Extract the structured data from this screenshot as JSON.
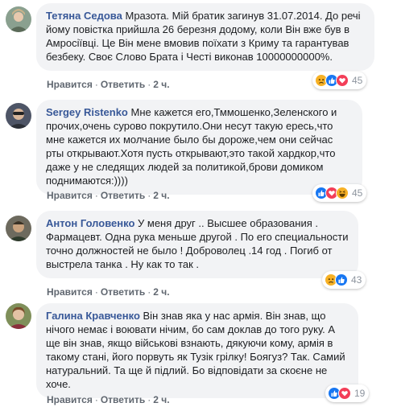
{
  "comments": [
    {
      "author": "Тетяна Седова",
      "text": "Мразота. Мій братик загинув 31.07.2014. До речі йому повістка прийшла 26 березня додому, коли Він вже був в Амросіївці. Це Він мене вмовив поїхати з Криму та гарантував безбеку. Своє Слово Брата і Честі виконав 10000000000%.",
      "like_label": "Нравится",
      "reply_label": "Ответить",
      "time": "2 ч.",
      "reactions": [
        "sad-icon",
        "like-icon",
        "love-icon"
      ],
      "reaction_count": "45"
    },
    {
      "author": "Sergey Ristenko",
      "text": "Мне кажется его,Тммошенко,Зеленского и прочих,очень сурово покрутило.Они несут такую ересь,что мне кажется их молчание было бы дороже,чем они сейчас рты открывают.Хотя пусть открывают,это такой хардкор,что даже у не следящих людей за политикой,брови домиком поднимаются:))))",
      "like_label": "Нравится",
      "reply_label": "Ответить",
      "time": "2 ч.",
      "reactions": [
        "like-icon",
        "love-icon",
        "haha-icon"
      ],
      "reaction_count": "45"
    },
    {
      "author": "Антон Головенко",
      "text": "У меня друг .. Высшее образования . Фармацевт. Одна рука меньше другой . По его специальности точно должностей не было ! Доброволец .14 год . Погиб от выстрела танка . Ну как то так .",
      "like_label": "Нравится",
      "reply_label": "Ответить",
      "time": "2 ч.",
      "reactions": [
        "sad-icon",
        "like-icon"
      ],
      "reaction_count": "43"
    },
    {
      "author": "Галина Кравченко",
      "text": "Він знав яка у нас армія. Він знав, що нічого немає і воювати нічим, бо сам доклав до того руку. А ще він знав, якщо військові взнають, дякуючи кому, армія в такому стані, його порвуть як Тузік грілку! Боягуз? Так. Самий натуральний. Та ще й підлий. Бо відповідати за скоєне не хоче.",
      "like_label": "Нравится",
      "reply_label": "Ответить",
      "time": "2 ч.",
      "reactions": [
        "like-icon",
        "love-icon"
      ],
      "reaction_count": "19"
    }
  ],
  "colors": {
    "author": "#385898",
    "bubble": "#f2f3f5",
    "like": "#1877f2",
    "love": "#f33e58",
    "sad": "#f7b125"
  }
}
